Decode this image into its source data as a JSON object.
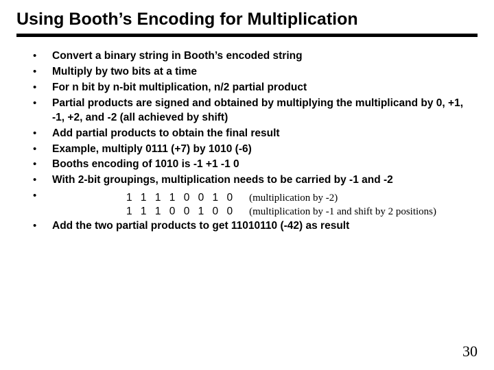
{
  "title": "Using Booth’s Encoding for Multiplication",
  "bullets": {
    "b0": "Convert a binary string in Booth’s encoded string",
    "b1": "Multiply by two bits at a time",
    "b2": "For n bit by n-bit multiplication, n/2 partial product",
    "b3": "Partial products are signed and obtained by multiplying the multiplicand by 0, +1, -1, +2, and -2 (all achieved by shift)",
    "b4": "Add partial products to obtain the final result",
    "b5": "Example, multiply 0111 (+7) by 1010 (-6)",
    "b6": "Booths encoding of 1010 is -1 +1 -1 0",
    "b7": "With 2-bit groupings, multiplication needs to be carried by -1 and -2",
    "b8": ""
  },
  "worked": {
    "row0": {
      "bits": "1 1 1 1 0 0 1 0",
      "note": "(multiplication by -2)"
    },
    "row1": {
      "bits": "1 1 1 0 0 1 0 0",
      "note": "(multiplication by -1 and shift by 2 positions)"
    }
  },
  "final": "Add the two partial products to get  11010110 (-42) as result",
  "page_number": "30"
}
